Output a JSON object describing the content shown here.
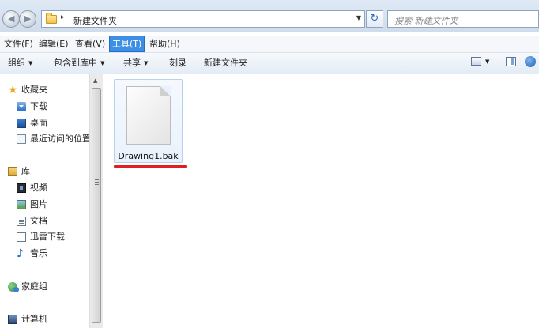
{
  "address_bar": {
    "path_separator": "▸",
    "path": "新建文件夹",
    "search_placeholder": "搜索 新建文件夹"
  },
  "menu": [
    "文件(F)",
    "编辑(E)",
    "查看(V)",
    "工具(T)",
    "帮助(H)"
  ],
  "active_menu_index": 3,
  "toolbar": [
    "组织",
    "包含到库中",
    "共享",
    "刻录",
    "新建文件夹"
  ],
  "nav": {
    "favorites": "收藏夹",
    "downloads": "下载",
    "desktop": "桌面",
    "recent": "最近访问的位置",
    "libraries": "库",
    "videos": "视频",
    "pictures": "图片",
    "documents": "文档",
    "thunder": "迅雷下载",
    "music": "音乐",
    "homegroup": "家庭组",
    "computer": "计算机"
  },
  "files": [
    {
      "name": "Drawing1.bak",
      "icon": "blank-file-icon",
      "selected": true
    }
  ],
  "annotation": {
    "color": "#e02020",
    "underlines": "Drawing1.bak"
  },
  "colors": {
    "menu_active": "#3d8ee5",
    "chrome": "#dfe9f5"
  }
}
